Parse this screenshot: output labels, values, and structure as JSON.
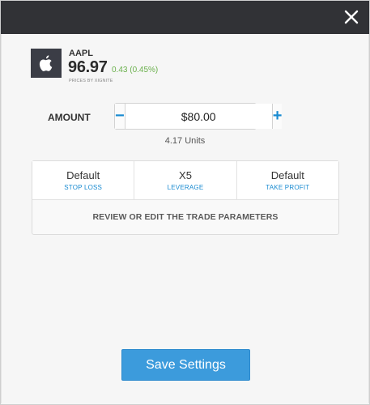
{
  "header": {
    "close_icon": "close-icon"
  },
  "instrument": {
    "logo_icon": "apple-logo-icon",
    "symbol": "AAPL",
    "price": "96.97",
    "change": "0.43 (0.45%)",
    "provider": "PRICES BY XIGNITE",
    "colors": {
      "change": "#6ab04c",
      "logo_bg": "#3b3d46"
    }
  },
  "amount": {
    "label": "AMOUNT",
    "value": "$80.00",
    "minus_label": "−",
    "plus_label": "+",
    "units": "4.17 Units"
  },
  "params": {
    "items": [
      {
        "value": "Default",
        "label": "STOP LOSS"
      },
      {
        "value": "X5",
        "label": "LEVERAGE"
      },
      {
        "value": "Default",
        "label": "TAKE PROFIT"
      }
    ],
    "review_label": "REVIEW OR EDIT THE TRADE PARAMETERS",
    "accent": "#1a8bd1"
  },
  "footer": {
    "save_label": "Save Settings",
    "save_color": "#3c9bdc"
  }
}
